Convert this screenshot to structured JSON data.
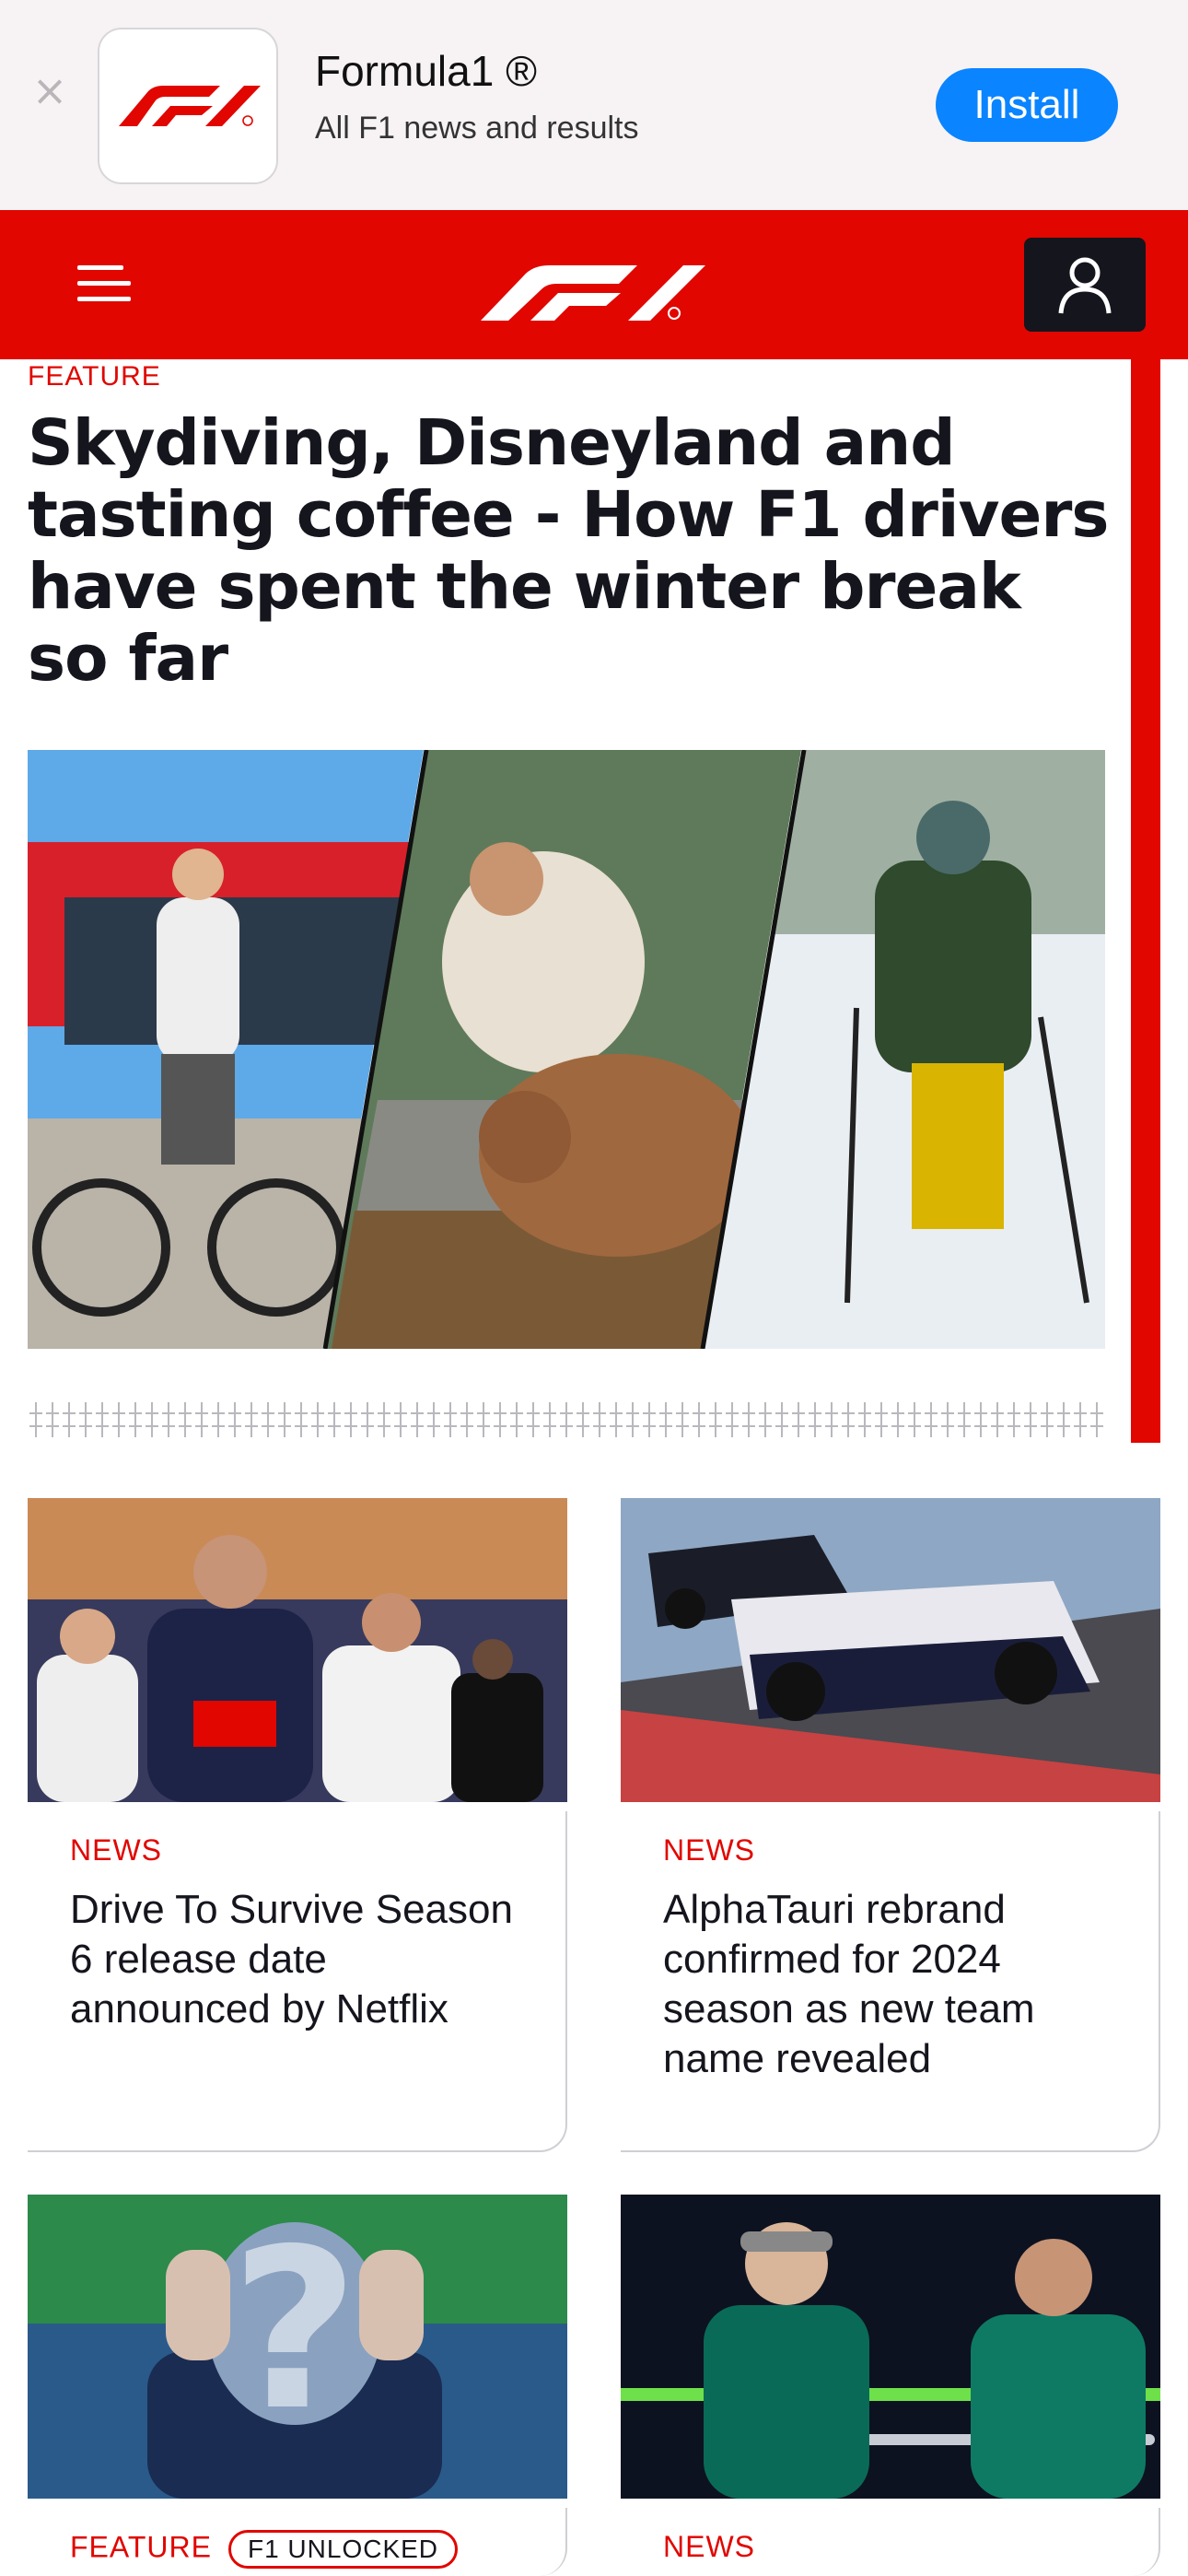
{
  "banner": {
    "close_icon": "close-icon",
    "app_name": "Formula1 ®",
    "app_subtitle": "All F1 news and results",
    "install_label": "Install"
  },
  "header": {
    "menu_icon": "hamburger-menu-icon",
    "logo": "F1",
    "account_icon": "user-icon"
  },
  "hero": {
    "tag": "FEATURE",
    "title": "Skydiving, Disneyland and tasting coffee - How F1 drivers have spent the winter break so far"
  },
  "cards": [
    {
      "tag": "NEWS",
      "title": "Drive To Survive Season 6 release date announced by Netflix"
    },
    {
      "tag": "NEWS",
      "title": "AlphaTauri rebrand confirmed for 2024 season as new team name revealed"
    },
    {
      "tag": "FEATURE",
      "badge": "F1 UNLOCKED",
      "title": ""
    },
    {
      "tag": "NEWS",
      "title": ""
    }
  ],
  "colors": {
    "brand_red": "#e10600",
    "ios_blue": "#0a84ff",
    "dark": "#15151e"
  }
}
